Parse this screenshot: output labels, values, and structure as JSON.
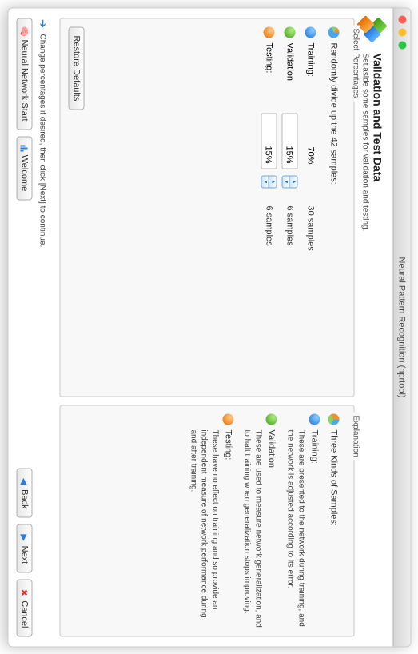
{
  "window": {
    "title": "Neural Pattern Recognition (nprtool)"
  },
  "header": {
    "title": "Validation and Test Data",
    "subtitle": "Set aside some samples for validation and testing."
  },
  "left": {
    "panel_title": "Select Percentages",
    "divide_text": "Randomly divide up the 42 samples:",
    "rows": {
      "training": {
        "label": "Training:",
        "percent": "70%",
        "samples": "30 samples"
      },
      "validation": {
        "label": "Validation:",
        "percent": "15%",
        "samples": "6 samples"
      },
      "testing": {
        "label": "Testing:",
        "percent": "15%",
        "samples": "6 samples"
      }
    },
    "restore_defaults": "Restore Defaults"
  },
  "right": {
    "panel_title": "Explanation",
    "heading": "Three Kinds of Samples:",
    "items": {
      "training": {
        "label": "Training:",
        "desc": "These are presented to the network during training, and the network is adjusted according to its error."
      },
      "validation": {
        "label": "Validation:",
        "desc": "These are used to measure network generalization, and to halt training when generalization stops improving."
      },
      "testing": {
        "label": "Testing:",
        "desc": "These have no effect on training and so provide an independent measure of network performance during and after training."
      }
    }
  },
  "status": {
    "text": "Change percentages if desired, then click [Next] to continue."
  },
  "footer": {
    "neural_start": "Neural Network Start",
    "welcome": "Welcome",
    "back": "Back",
    "next": "Next",
    "cancel": "Cancel"
  }
}
